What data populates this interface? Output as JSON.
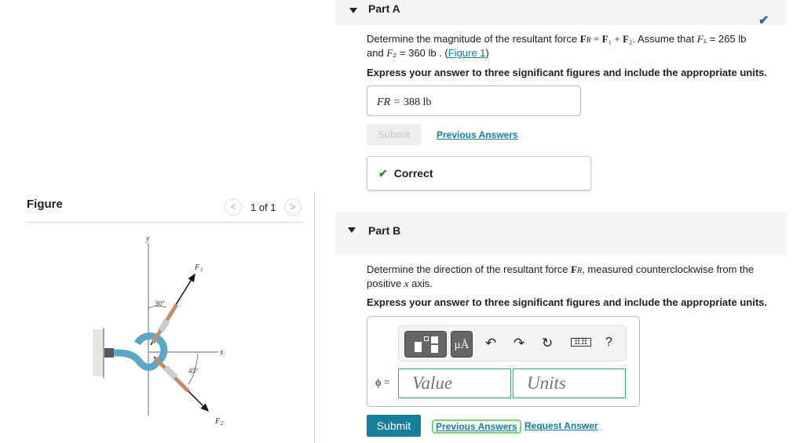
{
  "figure_panel": {
    "title": "Figure",
    "pager": "1 of 1",
    "prev_icon": "chevron-left-icon",
    "next_icon": "chevron-right-icon",
    "diagram_labels": [
      "y",
      "x",
      "F1",
      "F2",
      "30°",
      "45°"
    ]
  },
  "part_a": {
    "title": "Part A",
    "status_icon": "checkmark-icon",
    "question_pre": "Determine the magnitude of the resultant force ",
    "question_formula": "F",
    "question_mid": ". Assume that ",
    "f1_value": "= 265 lb",
    "line2_pre": "and ",
    "f2_value": "= 360 lb . (",
    "figure_link": "Figure 1",
    "line2_post": ")",
    "instruction": "Express your answer to three significant figures and include the appropriate units.",
    "answer_label": "FR =",
    "answer_value": "388 lb",
    "submit_label": "Submit",
    "previous_answers": "Previous Answers",
    "feedback": "Correct",
    "accent_green": "#2e8b2e"
  },
  "part_b": {
    "title": "Part B",
    "question_pre": "Determine the direction of the resultant force ",
    "question_post": ", measured counterclockwise from the",
    "line2_pre": "positive ",
    "line2_var": "x",
    "line2_post": " axis.",
    "instruction": "Express your answer to three significant figures and include the appropriate units.",
    "toolbar": [
      "templates-icon",
      "units-icon",
      "undo-icon",
      "redo-icon",
      "reset-icon",
      "keyboard-icon",
      "help-icon"
    ],
    "units_button": "μÅ",
    "help": "?",
    "variable_label": "ϕ =",
    "value_placeholder": "Value",
    "units_placeholder": "Units",
    "submit_label": "Submit",
    "previous_answers": "Previous Answers",
    "request_answer": "Request Answer",
    "accent_blue": "#167f9e"
  }
}
